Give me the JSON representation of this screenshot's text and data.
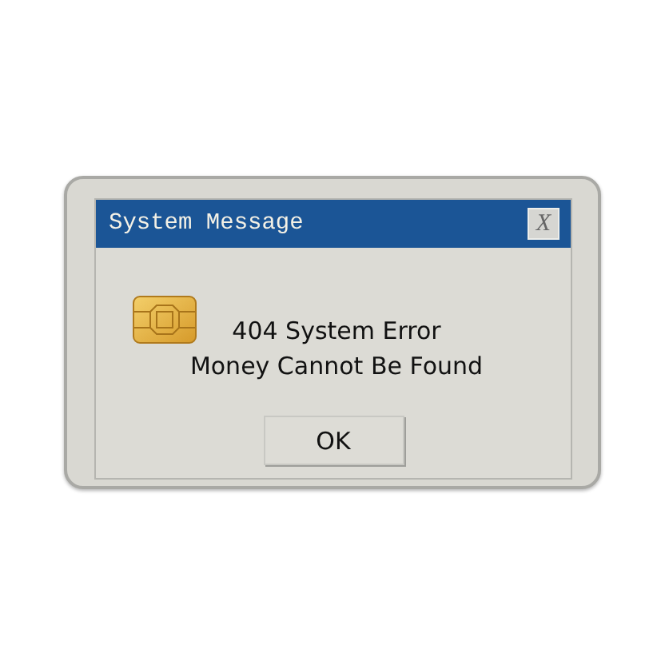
{
  "window": {
    "title": "System Message",
    "close_label": "X"
  },
  "message": [
    "404 System Error",
    "Money Cannot Be Found"
  ],
  "buttons": [
    "OK"
  ]
}
